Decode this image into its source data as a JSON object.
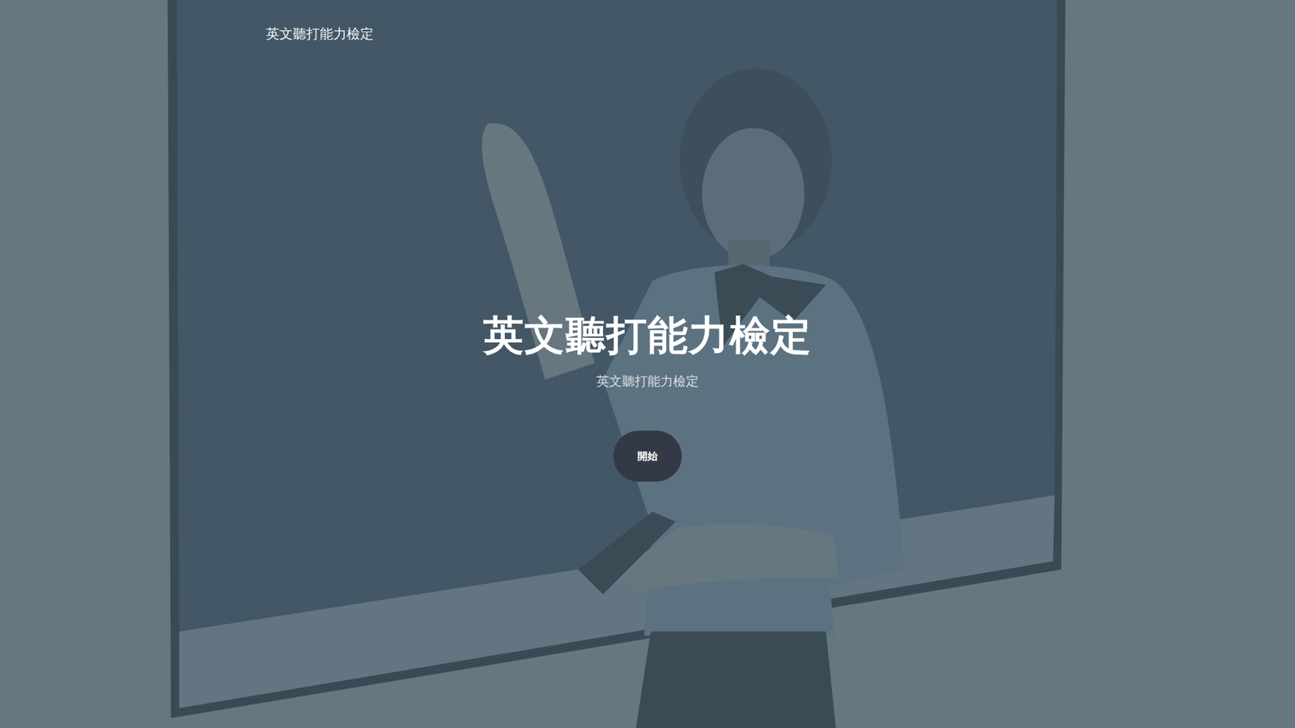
{
  "header": {
    "title": "英文聽打能力檢定"
  },
  "hero": {
    "title": "英文聽打能力檢定",
    "subtitle": "英文聽打能力檢定"
  },
  "buttons": [
    {
      "label": "開始"
    }
  ]
}
